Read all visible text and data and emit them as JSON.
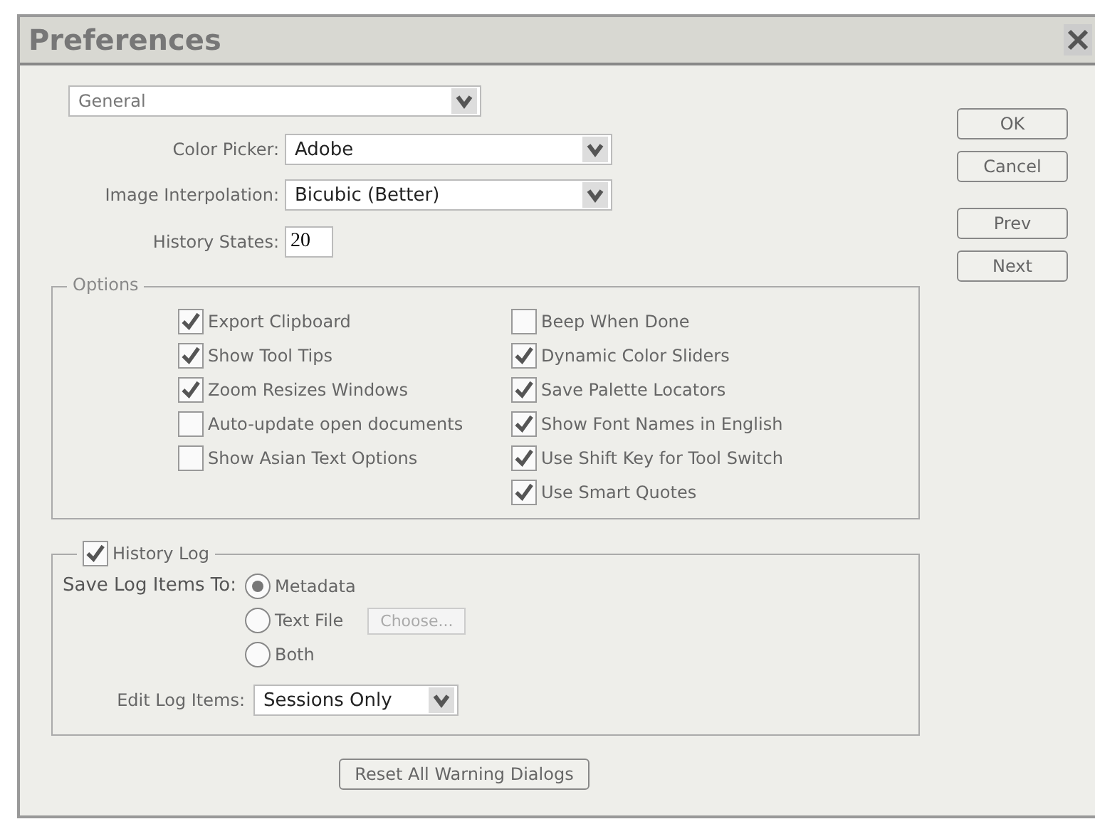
{
  "window": {
    "title": "Preferences"
  },
  "section_select": {
    "value": "General"
  },
  "fields": [
    {
      "kind": "select",
      "label": "Color Picker:",
      "value": "Adobe"
    },
    {
      "kind": "select",
      "label": "Image Interpolation:",
      "value": "Bicubic (Better)"
    },
    {
      "kind": "input",
      "label": "History States:",
      "value": "20"
    }
  ],
  "options": {
    "title": "Options",
    "columns": [
      [
        {
          "label": "Export Clipboard",
          "checked": true
        },
        {
          "label": "Show Tool Tips",
          "checked": true
        },
        {
          "label": "Zoom Resizes Windows",
          "checked": true
        },
        {
          "label": "Auto-update open documents",
          "checked": false
        },
        {
          "label": "Show Asian Text Options",
          "checked": false
        }
      ],
      [
        {
          "label": "Beep When Done",
          "checked": false
        },
        {
          "label": "Dynamic Color Sliders",
          "checked": true
        },
        {
          "label": "Save Palette Locators",
          "checked": true
        },
        {
          "label": "Show Font Names in English",
          "checked": true
        },
        {
          "label": "Use Shift Key for Tool Switch",
          "checked": true
        },
        {
          "label": "Use Smart Quotes",
          "checked": true
        }
      ]
    ]
  },
  "history_log": {
    "label": "History Log",
    "checked": true,
    "save_label": "Save Log Items To:",
    "radios": [
      {
        "label": "Metadata",
        "selected": true
      },
      {
        "label": "Text File",
        "selected": false,
        "button": "Choose..."
      },
      {
        "label": "Both",
        "selected": false
      }
    ],
    "edit_label": "Edit Log Items:",
    "edit_value": "Sessions Only"
  },
  "reset_button": "Reset All Warning Dialogs",
  "buttons": [
    "OK",
    "Cancel",
    "Prev",
    "Next"
  ]
}
